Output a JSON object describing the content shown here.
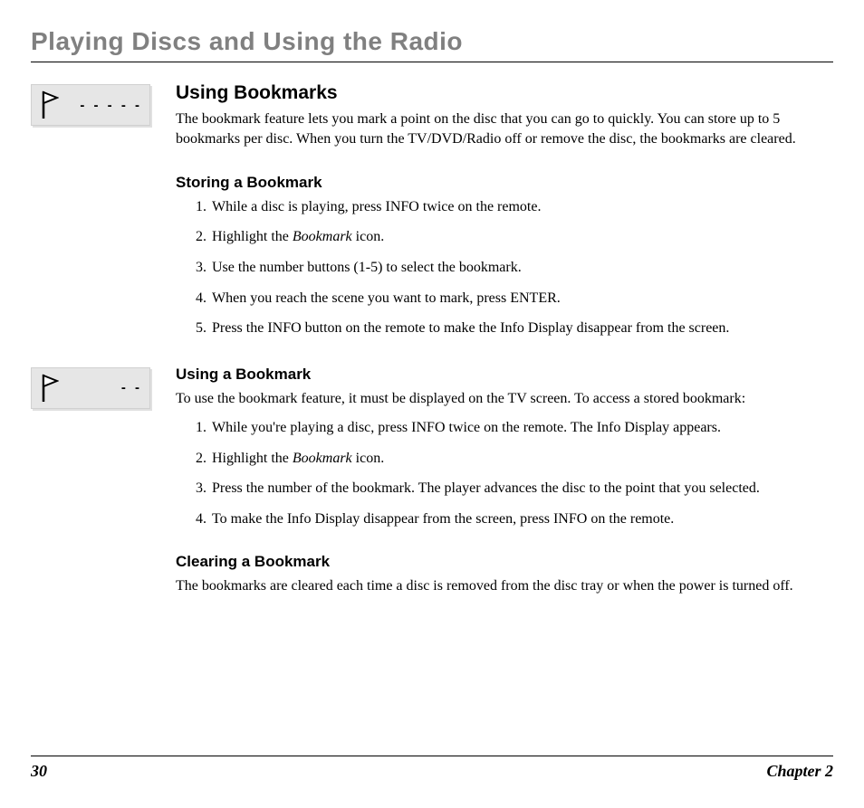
{
  "chapterTitle": "Playing Discs and Using the Radio",
  "icon1Dashes": "- - - - -",
  "icon2Dashes": "- -",
  "section1": {
    "title": "Using Bookmarks",
    "intro": "The bookmark feature lets you mark a point on the disc that you can go to quickly. You can store up to 5 bookmarks per disc. When you turn the TV/DVD/Radio off or remove the disc, the bookmarks are cleared."
  },
  "section2": {
    "title": "Storing a Bookmark",
    "steps": [
      "While a disc is playing, press INFO twice on the remote.",
      "Highlight the <span class=\"italic\">Bookmark</span> icon.",
      "Use the number buttons (1-5) to select the bookmark.",
      "When you reach the scene you want to mark, press ENTER.",
      "Press the INFO button on the remote to make the Info Display disappear from the screen."
    ]
  },
  "section3": {
    "title": "Using a Bookmark",
    "intro": "To use the bookmark feature, it must be displayed on the TV screen. To access a stored bookmark:",
    "steps": [
      "While you're playing a disc, press INFO twice on the remote. The Info Display appears.",
      "Highlight the <span class=\"italic\">Bookmark</span> icon.",
      "Press the number of the bookmark. The player advances the disc to the point that you selected.",
      "To make the Info Display disappear from the screen, press INFO on the remote."
    ]
  },
  "section4": {
    "title": "Clearing a Bookmark",
    "body": "The bookmarks are cleared each time a disc is removed from the disc tray or when the power is turned off."
  },
  "footer": {
    "pageNum": "30",
    "chapterLabel": "Chapter 2"
  }
}
